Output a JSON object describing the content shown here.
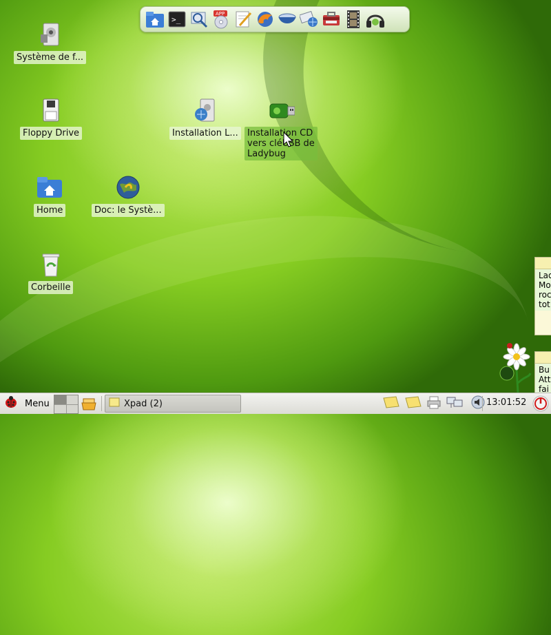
{
  "dock": {
    "items": [
      {
        "name": "home-folder-icon"
      },
      {
        "name": "terminal-icon"
      },
      {
        "name": "search-icon"
      },
      {
        "name": "app-installer-icon"
      },
      {
        "name": "text-editor-icon"
      },
      {
        "name": "firefox-icon"
      },
      {
        "name": "bowl-icon"
      },
      {
        "name": "network-icon"
      },
      {
        "name": "toolbox-icon"
      },
      {
        "name": "film-icon"
      },
      {
        "name": "headphones-icon"
      }
    ]
  },
  "desktop": {
    "icons": [
      {
        "id": "system",
        "label": "Système de f...",
        "icon": "drive-icon"
      },
      {
        "id": "floppy",
        "label": "Floppy Drive",
        "icon": "floppy-icon"
      },
      {
        "id": "install",
        "label": "Installation L...",
        "icon": "installer-icon"
      },
      {
        "id": "install_cd",
        "label": "Installation CD vers cléUSB de Ladybug",
        "icon": "usb-icon"
      },
      {
        "id": "home",
        "label": "Home",
        "icon": "home-folder-icon"
      },
      {
        "id": "doc",
        "label": "Doc: le Systè...",
        "icon": "globe-icon"
      },
      {
        "id": "trash",
        "label": "Corbeille",
        "icon": "trash-icon"
      }
    ]
  },
  "notes": [
    {
      "lines": [
        "Lad",
        "Mo",
        "roc",
        "tot"
      ]
    },
    {
      "lines": [
        "Bu",
        "Att",
        "fai"
      ]
    }
  ],
  "taskbar": {
    "menu_label": "Menu",
    "task_label": "Xpad (2)",
    "clock": "13:01:52",
    "tray_icons": [
      "note-icon",
      "note-icon",
      "printer-icon",
      "network-icon",
      "volume-icon"
    ]
  },
  "colors": {
    "desktop_green": "#86cc22",
    "taskbar_bg": "#e6e6e0",
    "power_red": "#d01818"
  }
}
